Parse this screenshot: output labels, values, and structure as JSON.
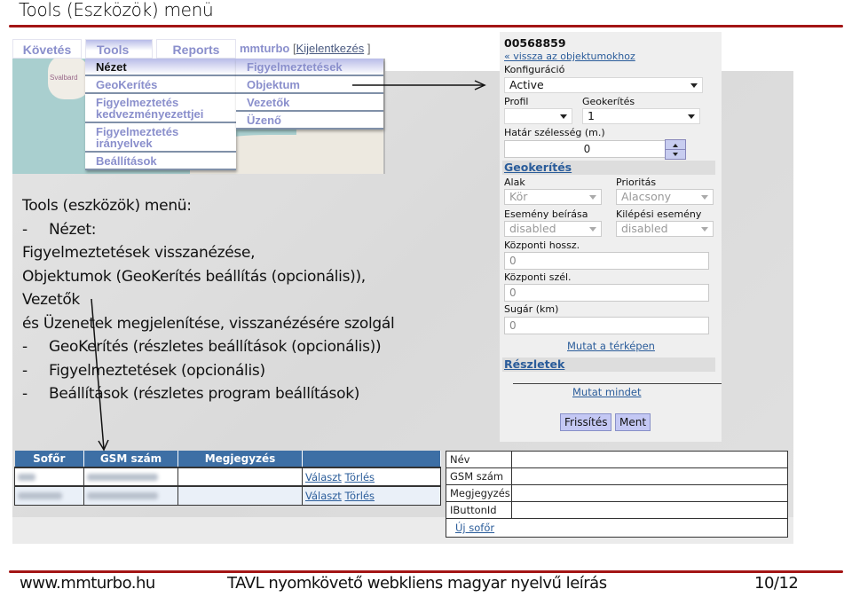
{
  "slide": {
    "title": "Tools (Eszközök) menü",
    "accent_color": "#a31515"
  },
  "app_menu": {
    "tabs": [
      {
        "label": "Követés"
      },
      {
        "label": "Tools",
        "active": true
      },
      {
        "label": "Reports"
      }
    ],
    "user": {
      "name": "mmturbo",
      "logout_label": "Kijelentkezés",
      "bracket_open": "[",
      "bracket_close": "]"
    },
    "tools_menu": [
      {
        "label": "Nézet",
        "active": true
      },
      {
        "label": "GeoKerítés"
      },
      {
        "label": "Figyelmeztetés kedvezményezettjei"
      },
      {
        "label": "Figyelmeztetés irányelvek"
      },
      {
        "label": "Beállítások"
      }
    ],
    "view_submenu": [
      {
        "label": "Figyelmeztetések"
      },
      {
        "label": "Objektum"
      },
      {
        "label": "Vezetők"
      },
      {
        "label": "Üzenő"
      }
    ],
    "map_label": "Svalbard"
  },
  "description": {
    "lines": [
      {
        "bullet": "",
        "text": "Tools (eszközök) menü:"
      },
      {
        "bullet": "-",
        "text": "Nézet:"
      },
      {
        "bullet": "",
        "text": "Figyelmeztetések visszanézése,"
      },
      {
        "bullet": "",
        "text": "Objektumok (GeoKerítés beállítás (opcionális)),"
      },
      {
        "bullet": "",
        "text": "Vezetők"
      },
      {
        "bullet": "",
        "text": "és Üzenetek megjelenítése, visszanézésére szolgál"
      },
      {
        "bullet": "-",
        "text": "GeoKerítés (részletes beállítások (opcionális))"
      },
      {
        "bullet": "-",
        "text": "Figyelmeztetések (opcionális)"
      },
      {
        "bullet": "-",
        "text": "Beállítások (részletes program beállítások)"
      }
    ]
  },
  "object_panel": {
    "object_id": "00568859",
    "back_link": "« vissza az objektumokhoz",
    "config_label": "Konfiguráció",
    "config_value": "Active",
    "profile_label": "Profil",
    "profile_value": "",
    "geofence_label": "Geokerítés",
    "geofence_value": "1",
    "border_width_label": "Határ szélesség (m.)",
    "border_width_value": "0",
    "geofence_section": "Geokerítés",
    "shape_label": "Alak",
    "shape_value": "Kör",
    "priority_label": "Prioritás",
    "priority_value": "Alacsony",
    "entry_event_label": "Esemény beírása",
    "entry_event_value": "disabled",
    "exit_event_label": "Kilépési esemény",
    "exit_event_value": "disabled",
    "center_lon_label": "Központi hossz.",
    "center_lon_value": "0",
    "center_lat_label": "Központi szél.",
    "center_lat_value": "0",
    "radius_label": "Sugár (km)",
    "radius_value": "0",
    "show_on_map": "Mutat a térképen",
    "details_section": "Részletek",
    "show_all": "Mutat mindet",
    "refresh_button": "Frissítés",
    "save_button": "Ment"
  },
  "drivers_table": {
    "columns": [
      "Sofőr",
      "GSM szám",
      "Megjegyzés",
      ""
    ],
    "rows": [
      {
        "driver": "[blurred]",
        "gsm": "[blurred]",
        "note": "",
        "select": "Választ",
        "delete": "Törlés"
      },
      {
        "driver": "[blurred]",
        "gsm": "[blurred]",
        "note": "",
        "select": "Választ",
        "delete": "Törlés"
      }
    ],
    "header_color": "#3d6fa5"
  },
  "new_driver_form": {
    "fields": [
      {
        "label": "Név",
        "value": ""
      },
      {
        "label": "GSM szám",
        "value": ""
      },
      {
        "label": "Megjegyzés",
        "value": ""
      },
      {
        "label": "IButtonId",
        "value": ""
      }
    ],
    "new_driver_link": "Új sofőr"
  },
  "footer": {
    "site": "www.mmturbo.hu",
    "doc_title": "TAVL nyomkövető webkliens magyar nyelvű leírás",
    "page": "10/12"
  }
}
